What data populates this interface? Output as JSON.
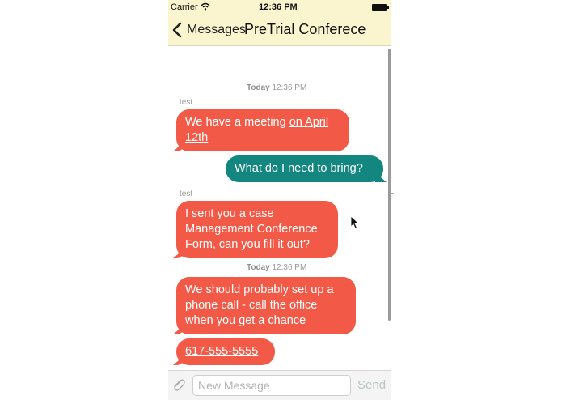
{
  "status_bar": {
    "carrier": "Carrier",
    "time": "12:36 PM"
  },
  "nav_bar": {
    "back_label": "Messages",
    "title": "PreTrial Conferece"
  },
  "thread": {
    "timestamps": [
      {
        "day": "Today",
        "time": "12:36 PM"
      },
      {
        "day": "Today",
        "time": "12:36 PM"
      }
    ],
    "senders": [
      "test",
      "test"
    ],
    "messages": [
      {
        "direction": "incoming",
        "text_before": "We have a meeting ",
        "link": "on April 12th"
      },
      {
        "direction": "outgoing",
        "text": "What do I need to bring?"
      },
      {
        "direction": "incoming",
        "text": "I sent you a case Management Conference Form, can you fill it out?"
      },
      {
        "direction": "incoming",
        "text": "We should probably set up a phone call - call the office when you get a chance"
      },
      {
        "direction": "incoming",
        "link": "617-555-5555"
      }
    ]
  },
  "input_bar": {
    "placeholder": "New Message",
    "send_label": "Send"
  },
  "colors": {
    "bar_background": "#fbf5cf",
    "incoming_bubble": "#f25a47",
    "outgoing_bubble": "#13877f",
    "send_disabled": "#b8c6c5"
  },
  "icons": [
    "wifi-icon",
    "battery-icon",
    "back-chevron-icon",
    "paperclip-icon",
    "mouse-cursor-icon"
  ]
}
